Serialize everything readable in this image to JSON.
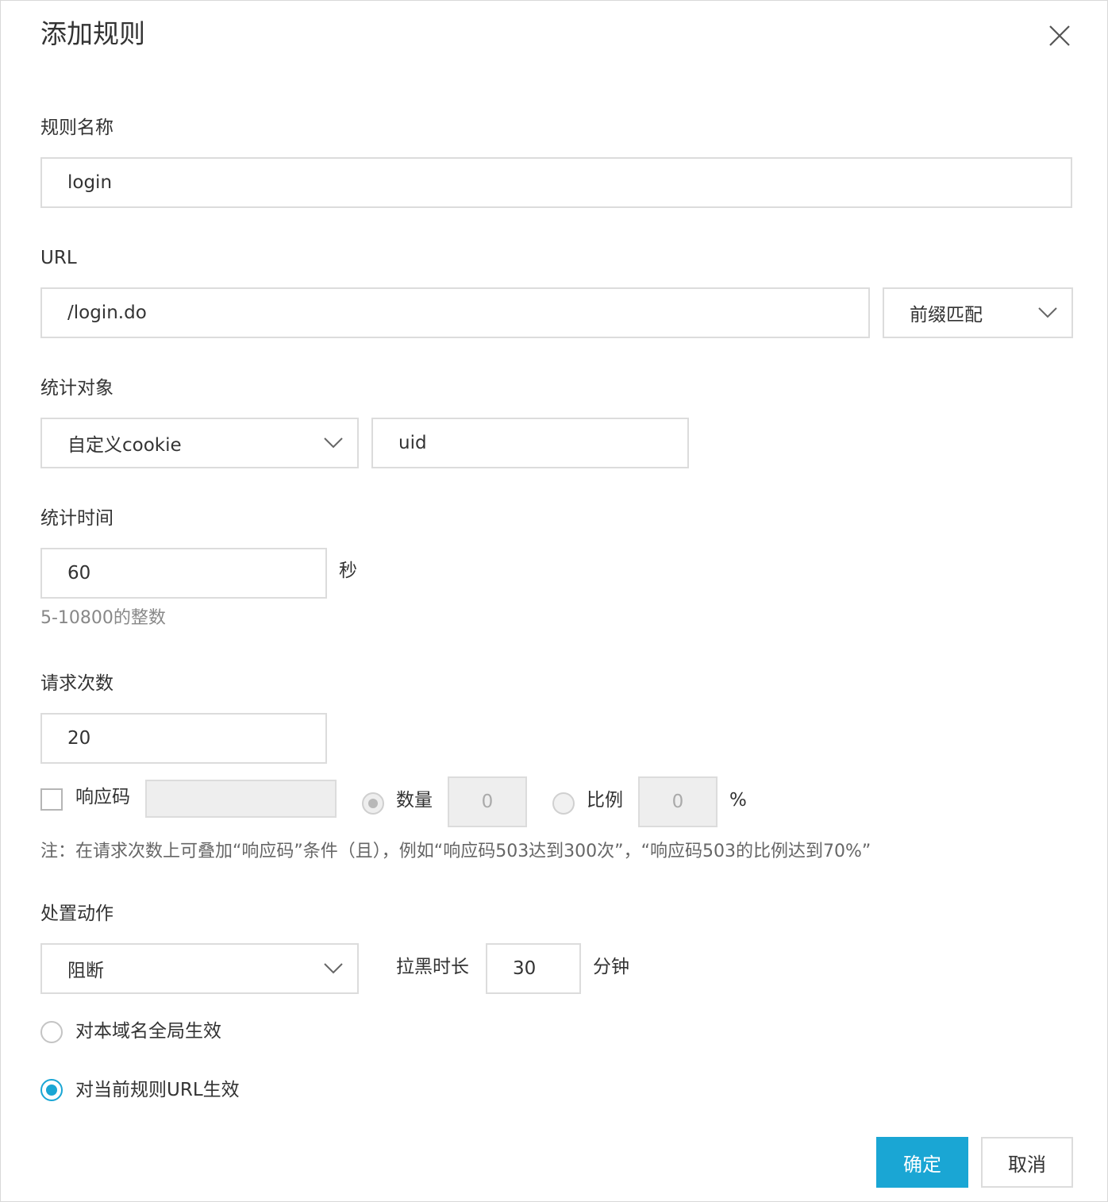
{
  "dialog": {
    "title": "添加规则"
  },
  "fields": {
    "rule_name": {
      "label": "规则名称",
      "value": "login"
    },
    "url": {
      "label": "URL",
      "value": "/login.do",
      "match_mode": "前缀匹配"
    },
    "stat_object": {
      "label": "统计对象",
      "type": "自定义cookie",
      "value": "uid"
    },
    "stat_time": {
      "label": "统计时间",
      "value": "60",
      "unit": "秒",
      "hint": "5-10800的整数"
    },
    "request_count": {
      "label": "请求次数",
      "value": "20"
    },
    "response_code": {
      "label": "响应码",
      "checked": false,
      "value": "",
      "count_label": "数量",
      "count_value": "0",
      "ratio_label": "比例",
      "ratio_value": "0",
      "ratio_unit": "%"
    },
    "note": "注：在请求次数上可叠加“响应码”条件（且），例如“响应码503达到300次”，“响应码503的比例达到70%”",
    "action": {
      "label": "处置动作",
      "value": "阻断",
      "block_duration_label": "拉黑时长",
      "block_duration_value": "30",
      "block_duration_unit": "分钟"
    },
    "scope": {
      "option_global": "对本域名全局生效",
      "option_url": "对当前规则URL生效",
      "selected": "option_url"
    }
  },
  "buttons": {
    "confirm": "确定",
    "cancel": "取消"
  },
  "colors": {
    "primary": "#1aa6d4",
    "border": "#dcdcdc"
  }
}
